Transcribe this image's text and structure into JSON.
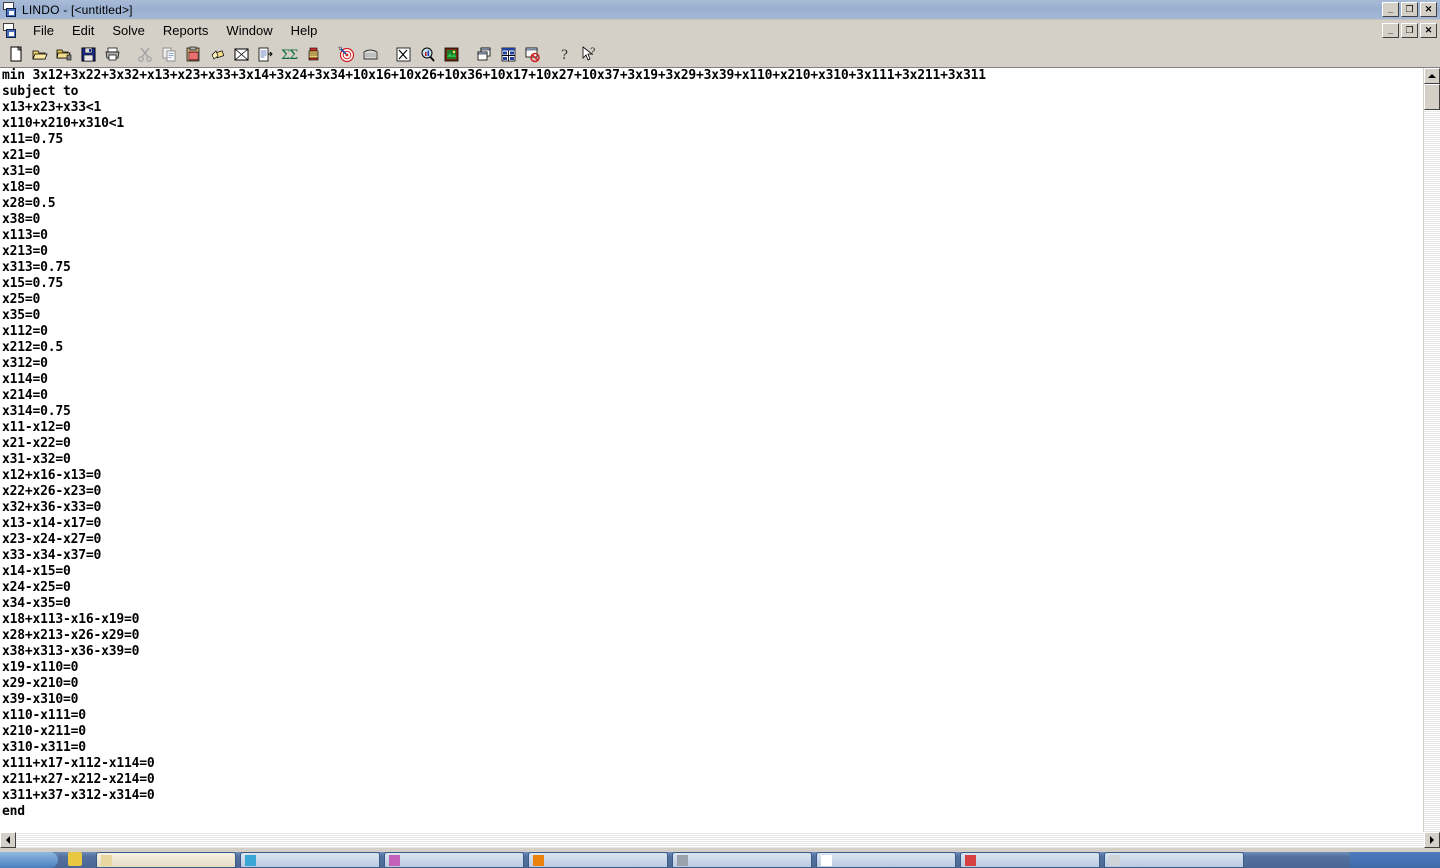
{
  "window": {
    "title": "LINDO - [<untitled>]",
    "app_icon_name": "lindo-app-icon",
    "controls": {
      "minimize": "_",
      "maximize": "❐",
      "close": "✕"
    }
  },
  "menubar": {
    "doc_icon_name": "lindo-document-icon",
    "items": [
      {
        "label": "File"
      },
      {
        "label": "Edit"
      },
      {
        "label": "Solve"
      },
      {
        "label": "Reports"
      },
      {
        "label": "Window"
      },
      {
        "label": "Help"
      }
    ],
    "child_controls": {
      "minimize": "_",
      "restore": "❐",
      "close": "✕"
    }
  },
  "toolbar": {
    "groups": [
      {
        "buttons": [
          {
            "name": "new-file-button",
            "icon": "new-document-icon"
          },
          {
            "name": "open-file-button",
            "icon": "open-folder-icon"
          },
          {
            "name": "save-as-button",
            "icon": "folder-lock-icon"
          },
          {
            "name": "save-button",
            "icon": "floppy-disk-icon"
          },
          {
            "name": "print-button",
            "icon": "printer-icon"
          }
        ]
      },
      {
        "buttons": [
          {
            "name": "cut-button",
            "icon": "scissors-icon"
          },
          {
            "name": "copy-button",
            "icon": "copy-pages-icon"
          },
          {
            "name": "paste-button",
            "icon": "clipboard-icon"
          },
          {
            "name": "find-button",
            "icon": "flashlight-icon"
          },
          {
            "name": "clear-button",
            "icon": "crossed-box-icon"
          },
          {
            "name": "options-button",
            "icon": "document-arrow-icon"
          },
          {
            "name": "sum-button",
            "icon": "sigma-icon"
          },
          {
            "name": "pivot-button",
            "icon": "fire-hydrant-icon"
          }
        ]
      },
      {
        "buttons": [
          {
            "name": "solve-button",
            "icon": "target-dart-icon"
          },
          {
            "name": "compile-button",
            "icon": "toaster-icon"
          }
        ]
      },
      {
        "buttons": [
          {
            "name": "export-button",
            "icon": "spreadsheet-x-icon"
          },
          {
            "name": "zoom-button",
            "icon": "magnifier-chart-icon"
          },
          {
            "name": "picture-button",
            "icon": "picture-frame-icon"
          }
        ]
      },
      {
        "buttons": [
          {
            "name": "cascade-windows-button",
            "icon": "cascade-windows-icon"
          },
          {
            "name": "tile-windows-button",
            "icon": "tile-windows-icon"
          },
          {
            "name": "close-window-button",
            "icon": "window-deny-icon"
          }
        ]
      },
      {
        "buttons": [
          {
            "name": "help-button",
            "icon": "question-mark-icon"
          },
          {
            "name": "context-help-button",
            "icon": "arrow-question-icon"
          }
        ]
      }
    ]
  },
  "editor": {
    "lines": [
      "min 3x12+3x22+3x32+x13+x23+x33+3x14+3x24+3x34+10x16+10x26+10x36+10x17+10x27+10x37+3x19+3x29+3x39+x110+x210+x310+3x111+3x211+3x311",
      "subject to",
      "x13+x23+x33<1",
      "x110+x210+x310<1",
      "x11=0.75",
      "x21=0",
      "x31=0",
      "x18=0",
      "x28=0.5",
      "x38=0",
      "x113=0",
      "x213=0",
      "x313=0.75",
      "x15=0.75",
      "x25=0",
      "x35=0",
      "x112=0",
      "x212=0.5",
      "x312=0",
      "x114=0",
      "x214=0",
      "x314=0.75",
      "x11-x12=0",
      "x21-x22=0",
      "x31-x32=0",
      "x12+x16-x13=0",
      "x22+x26-x23=0",
      "x32+x36-x33=0",
      "x13-x14-x17=0",
      "x23-x24-x27=0",
      "x33-x34-x37=0",
      "x14-x15=0",
      "x24-x25=0",
      "x34-x35=0",
      "x18+x113-x16-x19=0",
      "x28+x213-x26-x29=0",
      "x38+x313-x36-x39=0",
      "x19-x110=0",
      "x29-x210=0",
      "x39-x310=0",
      "x110-x111=0",
      "x210-x211=0",
      "x310-x311=0",
      "x111+x17-x112-x114=0",
      "x211+x27-x212-x214=0",
      "x311+x37-x312-x314=0",
      "end"
    ]
  },
  "scrollbars": {
    "vertical": {
      "up_arrow": "▲",
      "down_arrow": "▼"
    },
    "horizontal": {
      "left_arrow": "◄",
      "right_arrow": "►"
    }
  },
  "taskbar": {
    "start_label": "",
    "tasks": [
      {
        "name": "task-button-1",
        "color": "#3aa6d6"
      },
      {
        "name": "task-button-2",
        "color": "#c45fb8"
      },
      {
        "name": "task-button-3",
        "color": "#e8820c"
      },
      {
        "name": "task-button-4",
        "color": "#9aa3ad"
      },
      {
        "name": "task-button-5",
        "color": "#ffffff"
      },
      {
        "name": "task-button-6",
        "color": "#d64040"
      },
      {
        "name": "task-button-7",
        "color": "#cfd4da"
      }
    ],
    "tray_time": ""
  },
  "colors": {
    "titlebar": "#9fb4d4",
    "chrome": "#d4d0c8",
    "editor_bg": "#ffffff",
    "text": "#000000"
  }
}
